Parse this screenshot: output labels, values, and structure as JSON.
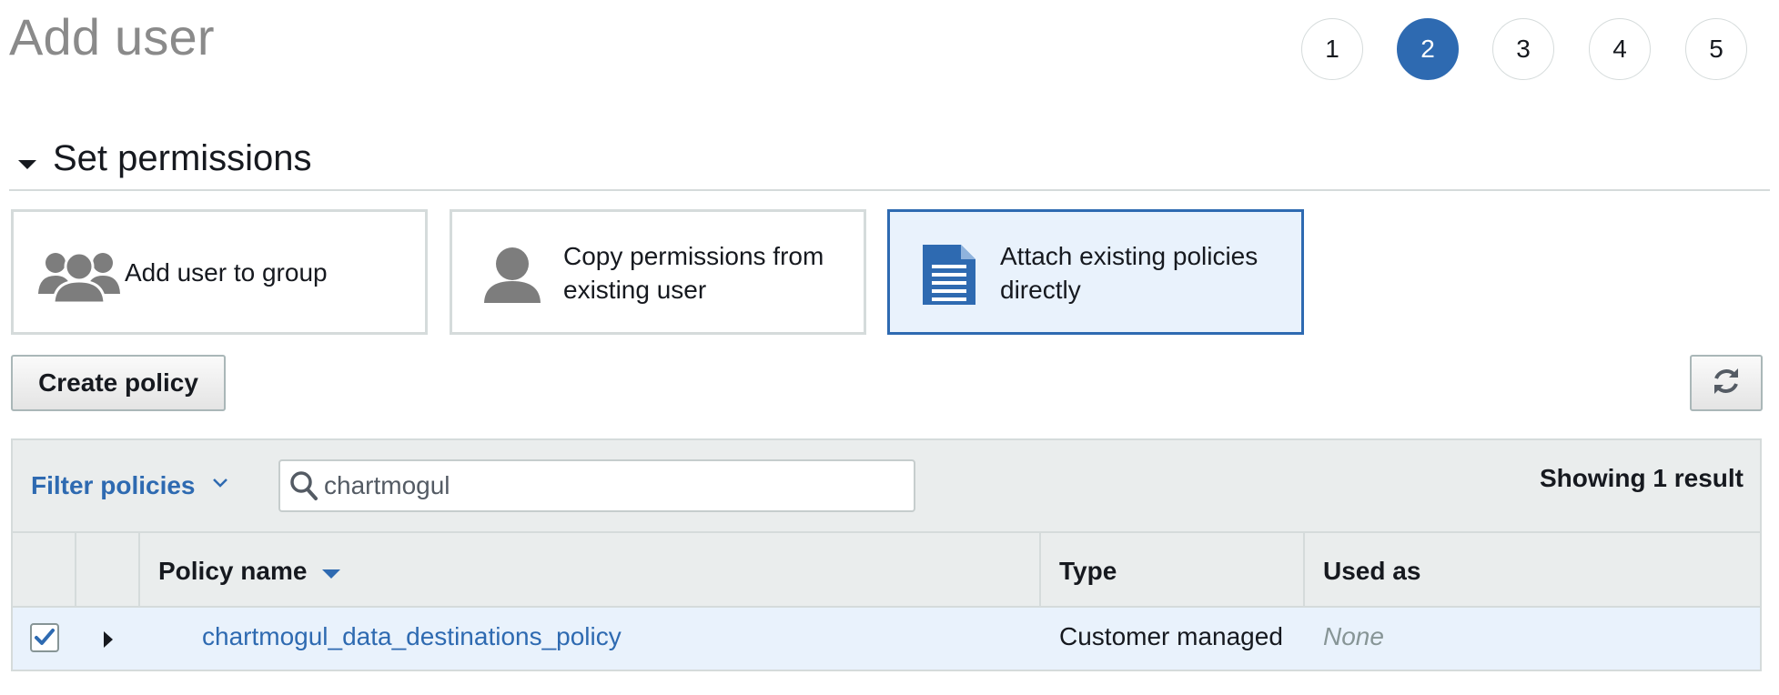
{
  "page": {
    "title": "Add user"
  },
  "steps": [
    "1",
    "2",
    "3",
    "4",
    "5"
  ],
  "active_step": "2",
  "section": {
    "title": "Set permissions"
  },
  "options": [
    {
      "label_line1": "Add user to group",
      "label_line2": "",
      "icon": "users-group-icon",
      "selected": false
    },
    {
      "label_line1": "Copy permissions from",
      "label_line2": "existing user",
      "icon": "user-icon",
      "selected": false
    },
    {
      "label_line1": "Attach existing policies",
      "label_line2": "directly",
      "icon": "document-icon",
      "selected": true
    }
  ],
  "toolbar": {
    "create_policy_label": "Create policy",
    "refresh_icon": "refresh-icon"
  },
  "filter": {
    "label": "Filter policies",
    "search_value": "chartmogul",
    "result_count": "Showing 1 result"
  },
  "table": {
    "columns": [
      "Policy name",
      "Type",
      "Used as"
    ],
    "rows": [
      {
        "checked": true,
        "name": "chartmogul_data_destinations_policy",
        "type": "Customer managed",
        "used_as": "None"
      }
    ]
  },
  "colors": {
    "accent": "#2e6ab1",
    "selected_bg": "#e9f2fc",
    "header_bg": "#eaeded",
    "border": "#d5dbdb",
    "muted_text": "#879596",
    "title_text": "#8a8a8a"
  }
}
